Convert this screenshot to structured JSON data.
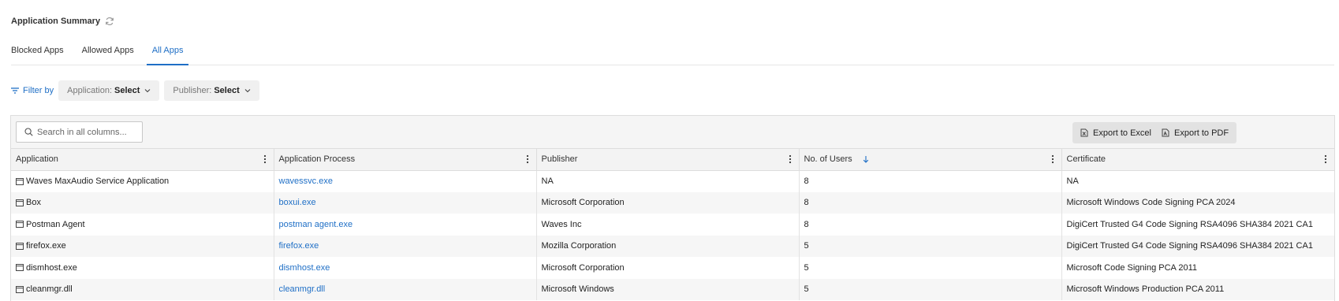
{
  "header": {
    "title": "Application Summary",
    "refresh_icon": "refresh-icon"
  },
  "tabs": [
    {
      "label": "Blocked Apps",
      "active": false
    },
    {
      "label": "Allowed Apps",
      "active": false
    },
    {
      "label": "All Apps",
      "active": true
    }
  ],
  "filters": {
    "filter_by_label": "Filter by",
    "application": {
      "label": "Application:",
      "value": "Select"
    },
    "publisher": {
      "label": "Publisher:",
      "value": "Select"
    }
  },
  "toolbar": {
    "search_placeholder": "Search in all columns...",
    "export_excel_label": "Export to Excel",
    "export_pdf_label": "Export to PDF"
  },
  "table": {
    "columns": [
      {
        "label": "Application"
      },
      {
        "label": "Application Process"
      },
      {
        "label": "Publisher"
      },
      {
        "label": "No. of Users",
        "sort": "descending"
      },
      {
        "label": "Certificate"
      }
    ],
    "rows": [
      {
        "application": "Waves MaxAudio Service Application",
        "process": "wavessvc.exe",
        "publisher": "NA",
        "users": "8",
        "certificate": "NA"
      },
      {
        "application": "Box",
        "process": "boxui.exe",
        "publisher": "Microsoft Corporation",
        "users": "8",
        "certificate": "Microsoft Windows Code Signing PCA 2024"
      },
      {
        "application": "Postman Agent",
        "process": "postman agent.exe",
        "publisher": "Waves Inc",
        "users": "8",
        "certificate": "DigiCert Trusted G4 Code Signing RSA4096 SHA384 2021 CA1"
      },
      {
        "application": "firefox.exe",
        "process": "firefox.exe",
        "publisher": "Mozilla Corporation",
        "users": "5",
        "certificate": "DigiCert Trusted G4 Code Signing RSA4096 SHA384 2021 CA1"
      },
      {
        "application": "dismhost.exe",
        "process": "dismhost.exe",
        "publisher": "Microsoft Corporation",
        "users": "5",
        "certificate": "Microsoft Code Signing PCA 2011"
      },
      {
        "application": "cleanmgr.dll",
        "process": "cleanmgr.dll",
        "publisher": "Microsoft Windows",
        "users": "5",
        "certificate": "Microsoft Windows Production PCA 2011"
      }
    ]
  },
  "colors": {
    "accent": "#1f6fc6",
    "header_bg": "#f3f3f3",
    "button_bg": "#e2e2e2"
  }
}
